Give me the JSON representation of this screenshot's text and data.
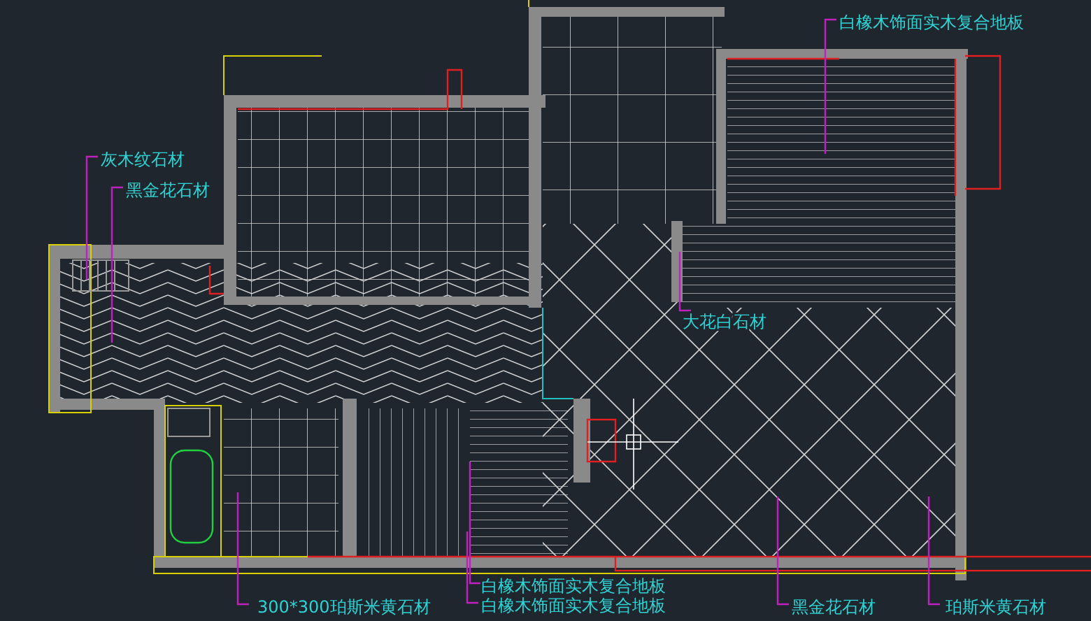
{
  "labels": [
    {
      "text": "白橡木饰面实木复合地板"
    },
    {
      "text": "灰木纹石材"
    },
    {
      "text": "黑金花石材"
    },
    {
      "text": "大花白石材"
    },
    {
      "text": "白橡木饰面实木复合地板"
    },
    {
      "text": "300*300珀斯米黄石材"
    },
    {
      "text": "白橡木饰面实木复合地板"
    },
    {
      "text": "黑金花石材"
    },
    {
      "text": "珀斯米黄石材"
    }
  ]
}
